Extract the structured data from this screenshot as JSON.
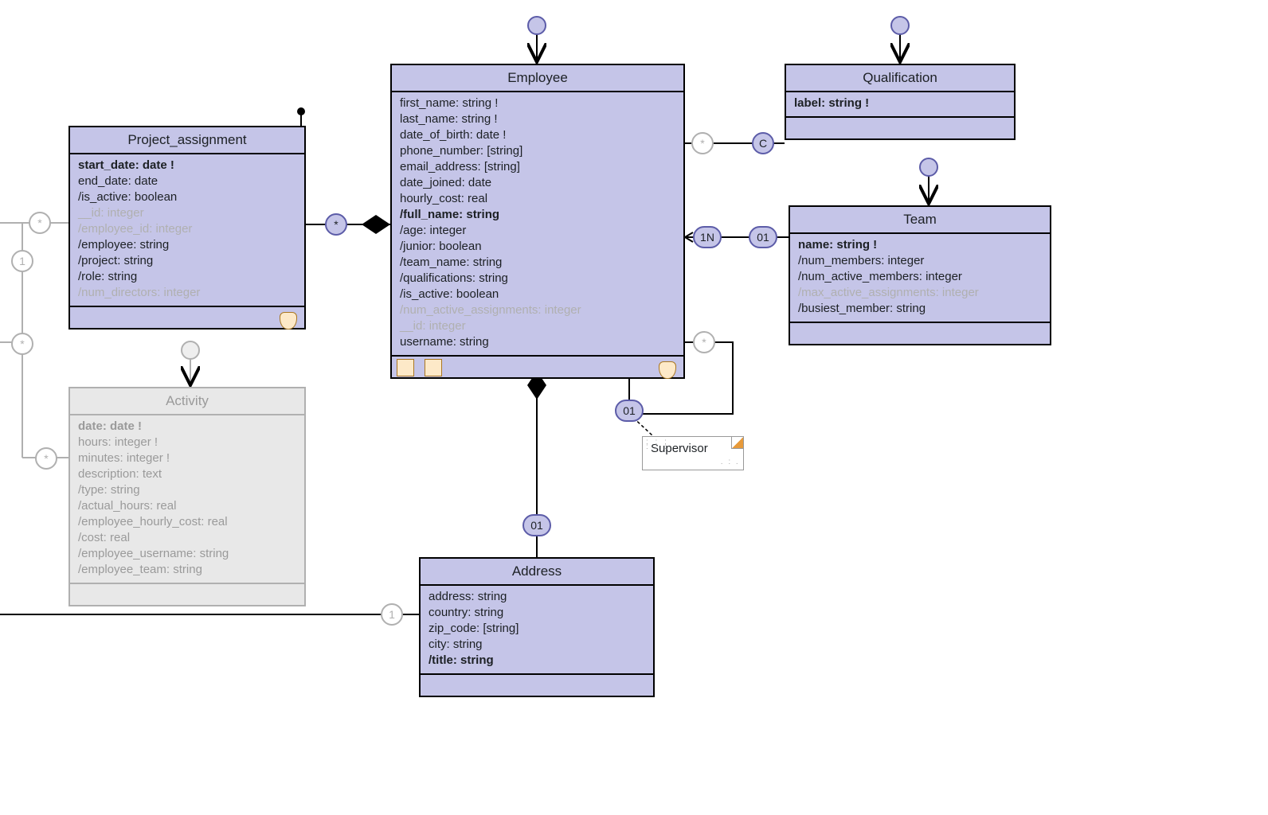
{
  "entities": {
    "project_assignment": {
      "title": "Project_assignment",
      "attrs": [
        {
          "text": "start_date: date !",
          "bold": true
        },
        {
          "text": "end_date: date"
        },
        {
          "text": "/is_active: boolean"
        },
        {
          "text": "__id: integer",
          "dim": true
        },
        {
          "text": "/employee_id: integer",
          "dim": true
        },
        {
          "text": "/employee: string"
        },
        {
          "text": "/project: string"
        },
        {
          "text": "/role: string"
        },
        {
          "text": "/num_directors: integer",
          "dim": true
        }
      ]
    },
    "employee": {
      "title": "Employee",
      "attrs": [
        {
          "text": "first_name: string !"
        },
        {
          "text": "last_name: string !"
        },
        {
          "text": "date_of_birth: date !"
        },
        {
          "text": "phone_number: [string]"
        },
        {
          "text": "email_address: [string]"
        },
        {
          "text": "date_joined: date"
        },
        {
          "text": "hourly_cost: real"
        },
        {
          "text": "/full_name: string",
          "bold": true
        },
        {
          "text": "/age: integer"
        },
        {
          "text": "/junior: boolean"
        },
        {
          "text": "/team_name: string"
        },
        {
          "text": "/qualifications: string"
        },
        {
          "text": "/is_active: boolean"
        },
        {
          "text": "/num_active_assignments: integer",
          "dim": true
        },
        {
          "text": "__id: integer",
          "dim": true
        },
        {
          "text": "username: string"
        }
      ]
    },
    "qualification": {
      "title": "Qualification",
      "attrs": [
        {
          "text": "label: string !",
          "bold": true
        }
      ]
    },
    "team": {
      "title": "Team",
      "attrs": [
        {
          "text": "name: string !",
          "bold": true
        },
        {
          "text": "/num_members: integer"
        },
        {
          "text": "/num_active_members: integer"
        },
        {
          "text": "/max_active_assignments: integer",
          "dim": true
        },
        {
          "text": "/busiest_member: string"
        }
      ]
    },
    "activity": {
      "title": "Activity",
      "attrs": [
        {
          "text": "date: date !",
          "bold": true
        },
        {
          "text": "hours: integer !"
        },
        {
          "text": "minutes: integer !"
        },
        {
          "text": "description: text"
        },
        {
          "text": "/type: string"
        },
        {
          "text": "/actual_hours: real"
        },
        {
          "text": "/employee_hourly_cost: real"
        },
        {
          "text": "/cost: real"
        },
        {
          "text": "/employee_username: string"
        },
        {
          "text": "/employee_team: string"
        }
      ]
    },
    "address": {
      "title": "Address",
      "attrs": [
        {
          "text": "address: string"
        },
        {
          "text": "country: string"
        },
        {
          "text": "zip_code: [string]"
        },
        {
          "text": "city: string"
        },
        {
          "text": "/title: string",
          "bold": true
        }
      ]
    }
  },
  "note_supervisor": "Supervisor",
  "cardinalities": {
    "pa_emp_star": "*",
    "emp_qual_star": "*",
    "emp_qual_c": "C",
    "emp_team_1n": "1N",
    "emp_team_01": "01",
    "emp_sup_star": "*",
    "emp_sup_01": "01",
    "emp_addr_01": "01",
    "addr_left_1": "1",
    "pa_left_star": "*",
    "pa_left_1": "1",
    "act_left_star": "*",
    "act_left_star2": "*"
  }
}
